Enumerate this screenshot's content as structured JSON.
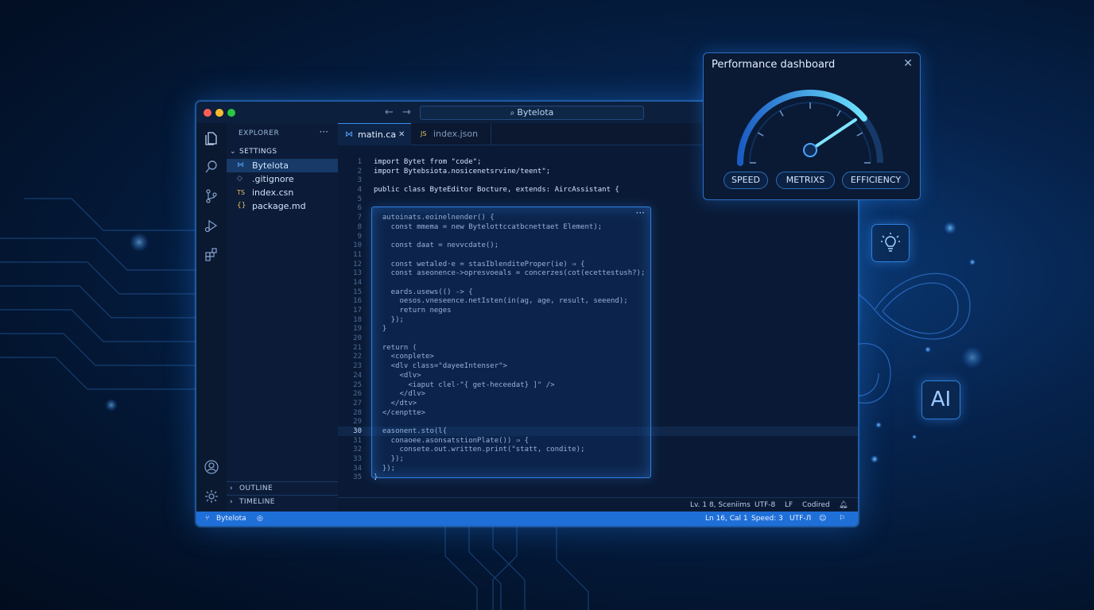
{
  "window": {
    "search_text": "Bytelota",
    "nav_back": "←",
    "nav_forward": "→"
  },
  "explorer": {
    "header": "EXPLORER",
    "menu": "···",
    "folder": "SETTINGS",
    "files": [
      {
        "icon": "vscode-icon",
        "glyph": "⋈",
        "label": "Bytelota"
      },
      {
        "icon": "gitignore-icon",
        "glyph": "◇",
        "label": ".gitignore"
      },
      {
        "icon": "ts-file-icon",
        "glyph": "TS",
        "label": "index.csn"
      },
      {
        "icon": "json-file-icon",
        "glyph": "{}",
        "label": "package.md"
      }
    ],
    "sections": [
      "OUTLINE",
      "TIMELINE"
    ]
  },
  "tabs": [
    {
      "icon": "vscode-icon",
      "label": "matin.ca",
      "close": "✕",
      "active": true
    },
    {
      "icon": "js-file-icon",
      "label": "index.json",
      "active": false
    }
  ],
  "editor": {
    "line_numbers": [
      "1",
      "2",
      "3",
      "4",
      "5",
      "6",
      "7",
      "8",
      "9",
      "10",
      "11",
      "12",
      "13",
      "14",
      "15",
      "16",
      "17",
      "18",
      "19",
      "20",
      "21",
      "22",
      "23",
      "24",
      "25",
      "26",
      "27",
      "28",
      "29",
      "30",
      "31",
      "32",
      "33",
      "34",
      "35"
    ],
    "lines": [
      "import Bytet from \"code\";",
      "import Bytebsiota.nosicenetsrvine/teent\";",
      "",
      "public class ByteEditor Bocture, extends: AircAssistant {",
      "",
      "",
      "  autoinats.eoinelnender() {",
      "    const mmema = new Bytelottccatbcnettaet Element);",
      "",
      "    const daat = nevvcdate();",
      "",
      "    const wetaled·e = stasIblenditeProper(ie) ⇒ {",
      "    const aseonence-≻opresvoeals = concerzes(cot(ecettestush?);",
      "",
      "    eards.usews(() -> {",
      "      oesos.vneseence.netIsten(in(ag, age, result, seeend);",
      "      return neges",
      "    });",
      "  }",
      "",
      "  return (",
      "    <conplete>",
      "    <dlv class=\"dayeeIntenser\">",
      "      <dlv>",
      "        <iaput clel·\"{ get-heceedat} ]\" />",
      "      </dlv>",
      "    </dtv>",
      "  </cenptte>",
      "",
      "  easonent.sto(l{",
      "    conaoee.asonsatstionPlate()) ⇒ {",
      "      consete.out.written.print(\"statt, condite);",
      "    });",
      "  });",
      "}"
    ],
    "overlay_menu": "···"
  },
  "editor_status": {
    "position": "Lv. 1 8, Sceniims",
    "encoding": "UTF-8",
    "eol": "LF",
    "language": "Codired"
  },
  "statusbar": {
    "branch": "Bytelota",
    "cursor": "Ln 16, Cal 1",
    "speed": "Speed: 3",
    "encoding": "UTF-Л"
  },
  "dashboard": {
    "title": "Performance dashboard",
    "close": "✕",
    "gauge_value": 0.78,
    "buttons": [
      "SPEED",
      "METRIXS",
      "EFFICIENCY"
    ]
  },
  "floating": {
    "ai_label": "AI"
  },
  "colors": {
    "accent": "#1f6fd8",
    "glow": "#4aa3ff",
    "background": "#031530"
  }
}
